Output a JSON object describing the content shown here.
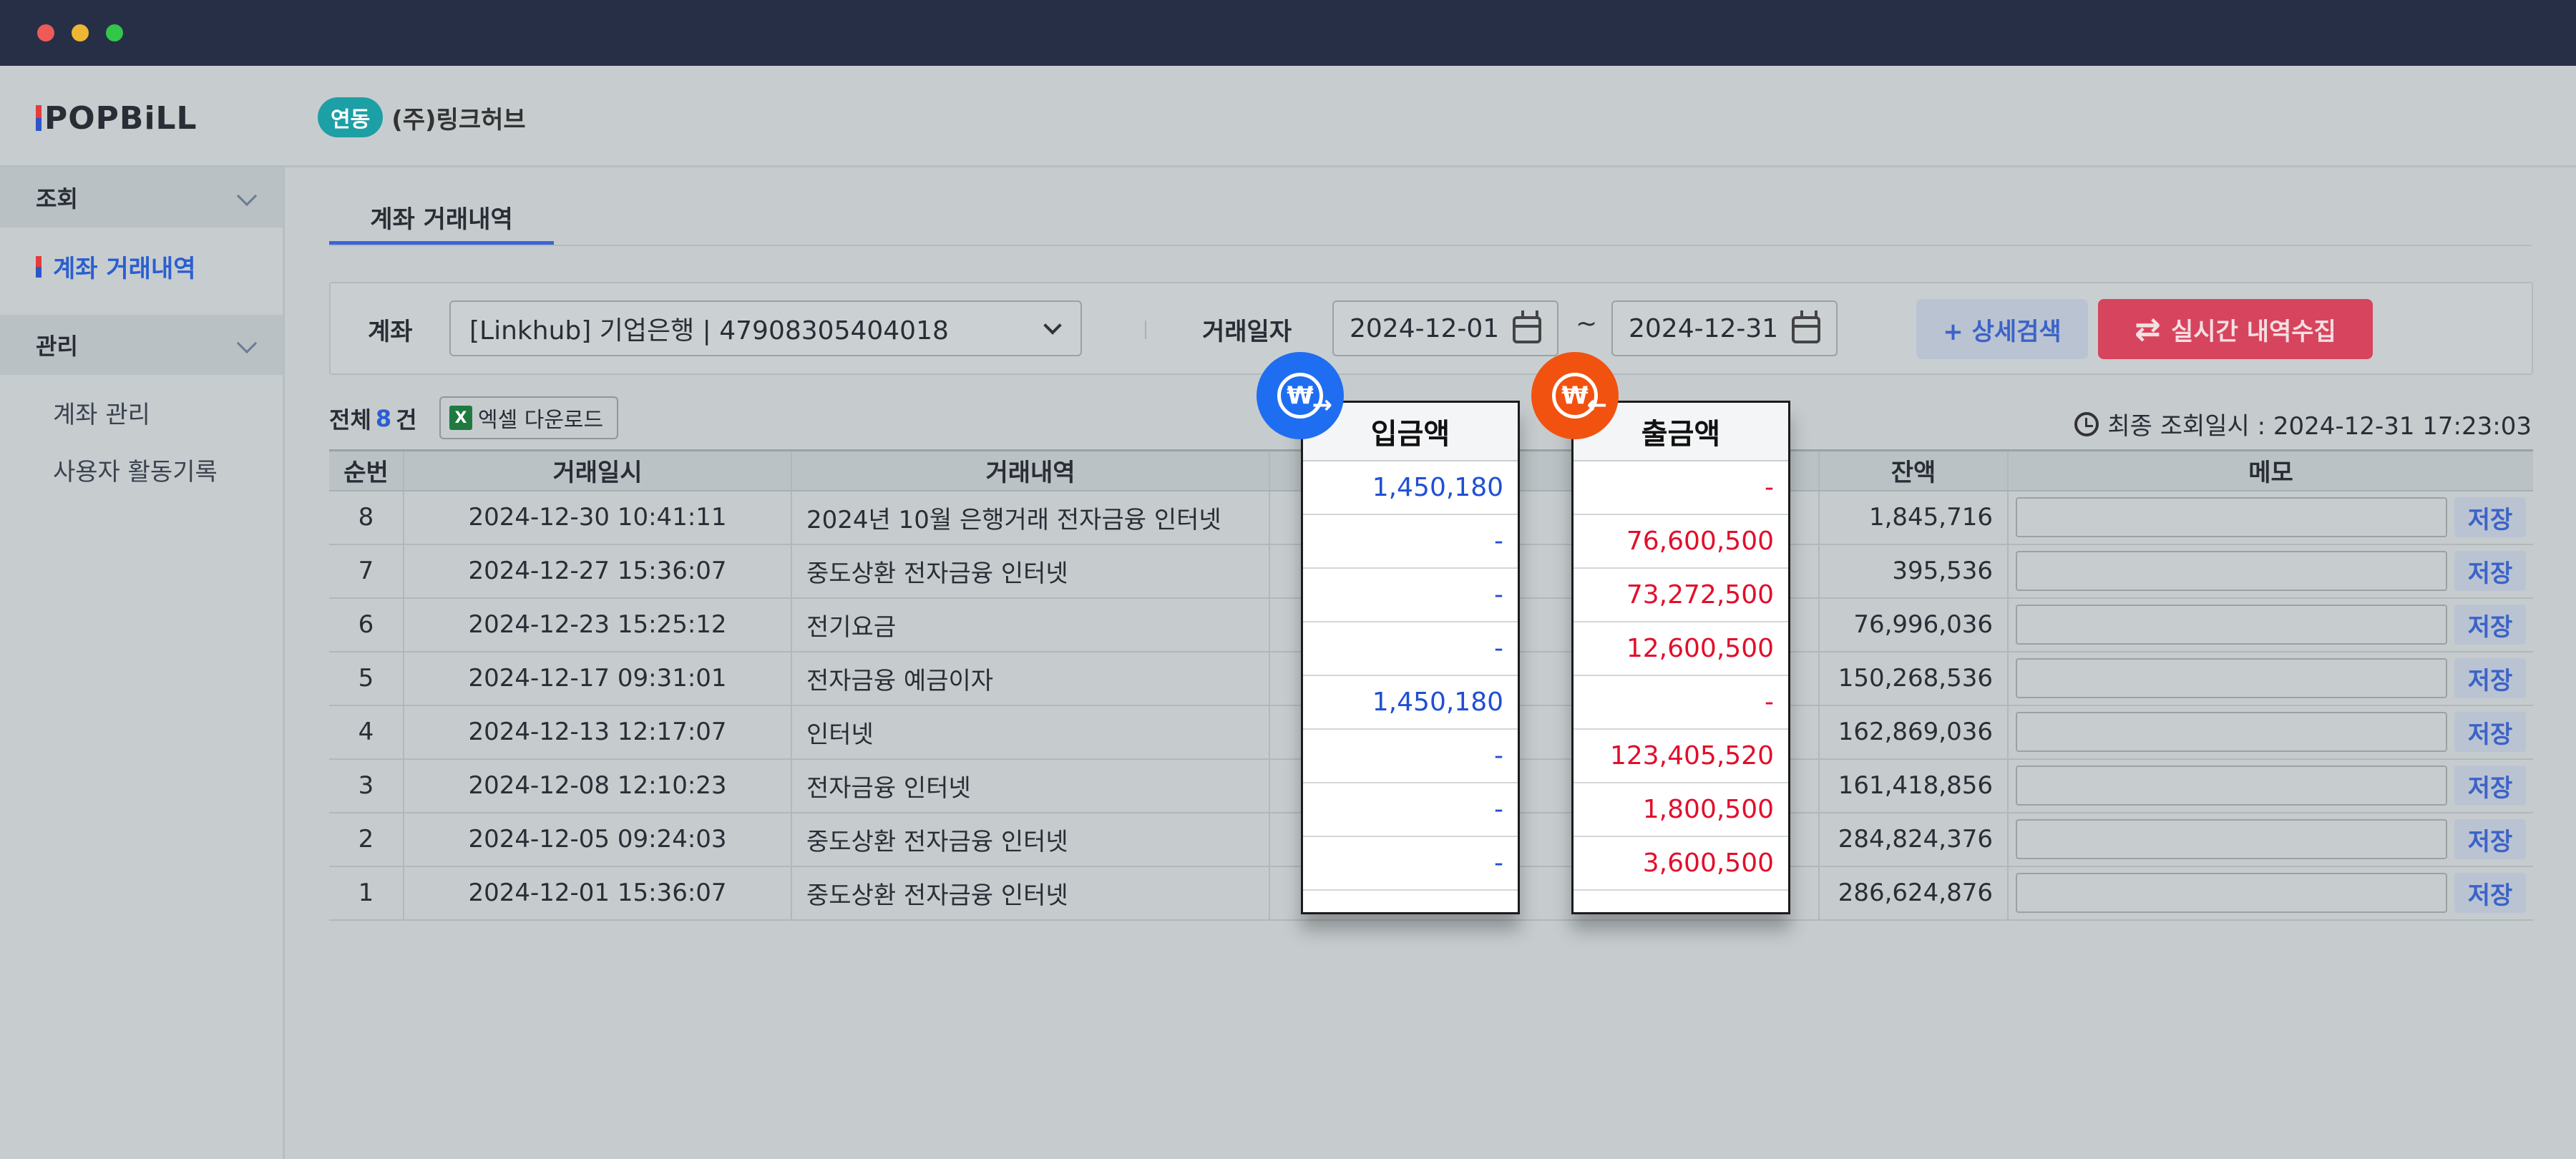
{
  "app": {
    "logo_text": "POPBiLL"
  },
  "header": {
    "badge": "연동",
    "company": "(주)링크허브"
  },
  "sidebar": {
    "group1": "조회",
    "active_item": "계좌 거래내역",
    "group2": "관리",
    "items": [
      "계좌 관리",
      "사용자 활동기록"
    ]
  },
  "tab": {
    "label": "계좌 거래내역"
  },
  "filter": {
    "account_label": "계좌",
    "account_value": "[Linkhub] 기업은행 | 47908305404018",
    "date_label": "거래일자",
    "date_from": "2024-12-01",
    "date_sep": "~",
    "date_to": "2024-12-31",
    "detail_button": "+ 상세검색",
    "live_button": "실시간 내역수집"
  },
  "summary": {
    "total_prefix": "전체",
    "total_count": "8",
    "total_suffix": "건",
    "excel_button": "엑셀 다운로드",
    "last_query": "최종 조회일시 : 2024-12-31 17:23:03"
  },
  "table": {
    "headers": {
      "no": "순번",
      "datetime": "거래일시",
      "desc": "거래내역",
      "balance": "잔액",
      "memo": "메모"
    },
    "save_label": "저장",
    "rows": [
      {
        "no": "8",
        "datetime": "2024-12-30 10:41:11",
        "desc": "2024년 10월 은행거래 전자금융 인터넷",
        "balance": "1,845,716"
      },
      {
        "no": "7",
        "datetime": "2024-12-27 15:36:07",
        "desc": "중도상환 전자금융 인터넷",
        "balance": "395,536"
      },
      {
        "no": "6",
        "datetime": "2024-12-23 15:25:12",
        "desc": "전기요금",
        "balance": "76,996,036"
      },
      {
        "no": "5",
        "datetime": "2024-12-17 09:31:01",
        "desc": "전자금융 예금이자",
        "balance": "150,268,536"
      },
      {
        "no": "4",
        "datetime": "2024-12-13 12:17:07",
        "desc": "인터넷",
        "balance": "162,869,036"
      },
      {
        "no": "3",
        "datetime": "2024-12-08 12:10:23",
        "desc": "전자금융 인터넷",
        "balance": "161,418,856"
      },
      {
        "no": "2",
        "datetime": "2024-12-05 09:24:03",
        "desc": "중도상환 전자금융 인터넷",
        "balance": "284,824,376"
      },
      {
        "no": "1",
        "datetime": "2024-12-01 15:36:07",
        "desc": "중도상환 전자금융 인터넷",
        "balance": "286,624,876"
      }
    ]
  },
  "deposit_card": {
    "title": "입금액",
    "values": [
      "1,450,180",
      "-",
      "-",
      "-",
      "1,450,180",
      "-",
      "-",
      "-"
    ]
  },
  "withdraw_card": {
    "title": "출금액",
    "values": [
      "-",
      "76,600,500",
      "73,272,500",
      "12,600,500",
      "-",
      "123,405,520",
      "1,800,500",
      "3,600,500"
    ]
  },
  "icons": {
    "won_symbol": "₩",
    "in_arrow": "→",
    "out_arrow": "←"
  },
  "colors": {
    "accent": "#3d63d6",
    "deposit": "#1f4fd4",
    "withdraw": "#e10f2c",
    "live_button": "#d7445e"
  }
}
